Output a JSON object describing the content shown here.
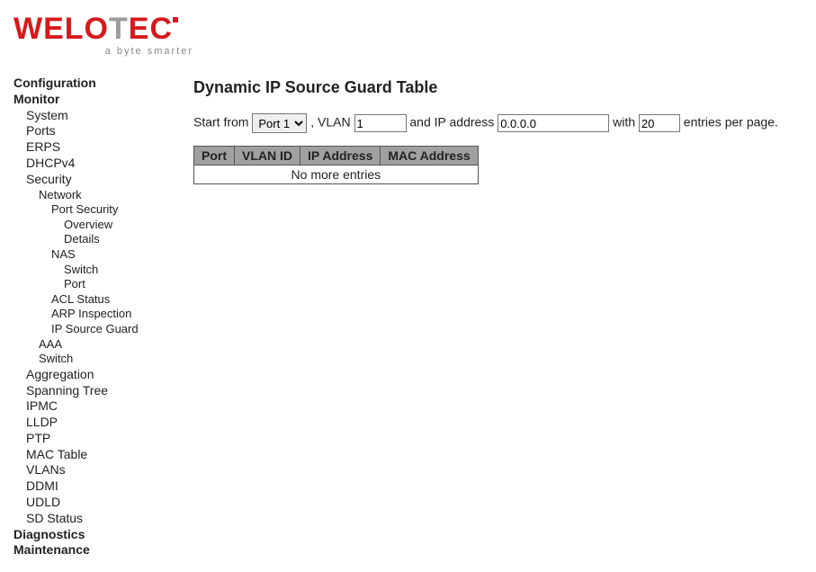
{
  "logo": {
    "text_pre": "WeLo",
    "text_t": "T",
    "text_post": "ec",
    "subtitle": "a byte smarter"
  },
  "nav": {
    "configuration": "Configuration",
    "monitor": "Monitor",
    "system": "System",
    "ports": "Ports",
    "erps": "ERPS",
    "dhcpv4": "DHCPv4",
    "security": "Security",
    "network": "Network",
    "port_security": "Port Security",
    "overview": "Overview",
    "details": "Details",
    "nas": "NAS",
    "switch": "Switch",
    "port": "Port",
    "acl_status": "ACL Status",
    "arp_inspection": "ARP Inspection",
    "ip_source_guard": "IP Source Guard",
    "aaa": "AAA",
    "switch2": "Switch",
    "aggregation": "Aggregation",
    "spanning_tree": "Spanning Tree",
    "ipmc": "IPMC",
    "lldp": "LLDP",
    "ptp": "PTP",
    "mac_table": "MAC Table",
    "vlans": "VLANs",
    "ddmi": "DDMI",
    "udld": "UDLD",
    "sd_status": "SD Status",
    "diagnostics": "Diagnostics",
    "maintenance": "Maintenance"
  },
  "page": {
    "title": "Dynamic IP Source Guard Table",
    "filter": {
      "start_from": "Start from",
      "port_selected": "Port 1",
      "vlan_label": ", VLAN",
      "vlan_value": "1",
      "ip_label": "and IP address",
      "ip_value": "0.0.0.0",
      "with_label": "with",
      "entries_value": "20",
      "entries_suffix": "entries per page."
    },
    "table": {
      "col_port": "Port",
      "col_vlan": "VLAN ID",
      "col_ip": "IP Address",
      "col_mac": "MAC Address",
      "no_entries": "No more entries"
    }
  }
}
